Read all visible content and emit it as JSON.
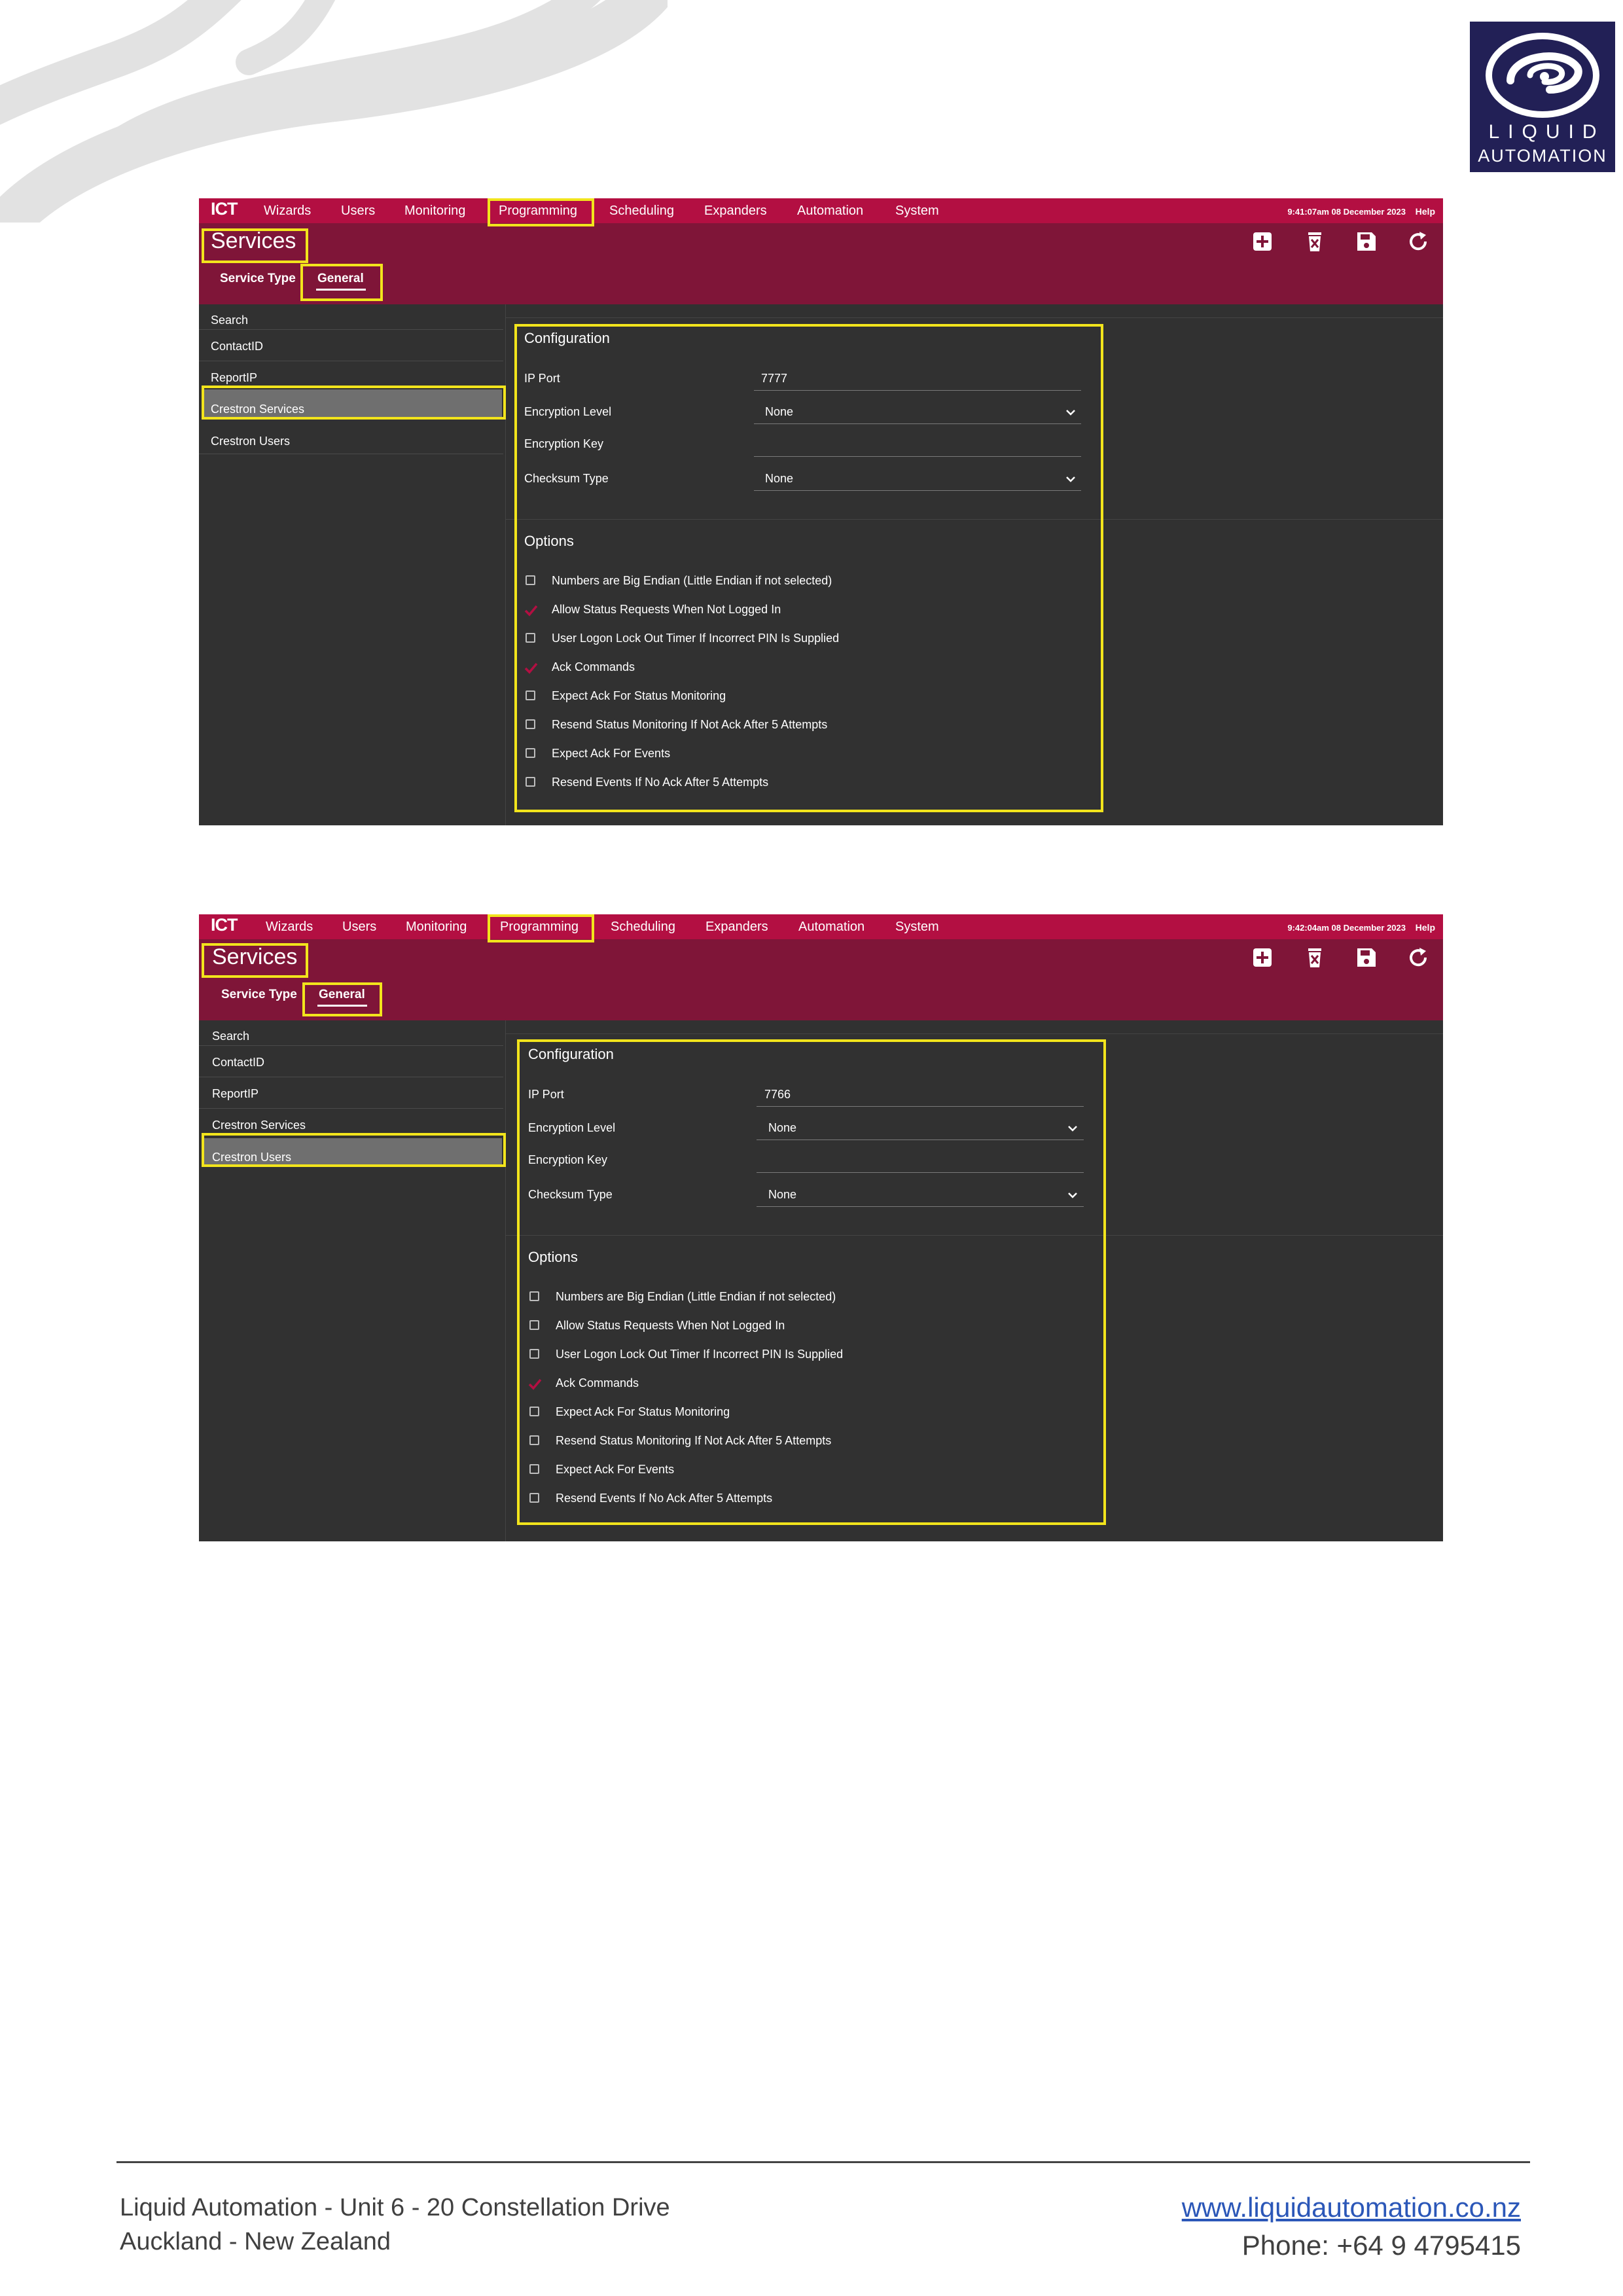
{
  "logo": {
    "line1": "LIQUID",
    "line2": "AUTOMATION"
  },
  "screenshots": [
    {
      "nav": {
        "brand": "ICT",
        "items": [
          "Wizards",
          "Users",
          "Monitoring",
          "Programming",
          "Scheduling",
          "Expanders",
          "Automation",
          "System"
        ],
        "highlighted": "Programming",
        "clock": "9:41:07am 08 December 2023",
        "help": "Help"
      },
      "page_title": "Services",
      "tabs": [
        "Service Type",
        "General"
      ],
      "active_tab": "General",
      "toolbar_icons": [
        "add-icon",
        "delete-icon",
        "save-icon",
        "refresh-icon"
      ],
      "sidebar": {
        "search": "Search",
        "items": [
          "ContactID",
          "ReportIP",
          "Crestron Services",
          "Crestron Users"
        ],
        "selected": "Crestron Services"
      },
      "configuration": {
        "title": "Configuration",
        "ip_port_label": "IP Port",
        "ip_port_value": "7777",
        "encryption_level_label": "Encryption Level",
        "encryption_level_value": "None",
        "encryption_key_label": "Encryption Key",
        "encryption_key_value": "",
        "checksum_type_label": "Checksum Type",
        "checksum_type_value": "None"
      },
      "options": {
        "title": "Options",
        "items": [
          {
            "label": "Numbers are Big Endian (Little Endian if not selected)",
            "checked": false
          },
          {
            "label": "Allow Status Requests When Not Logged In",
            "checked": true
          },
          {
            "label": "User Logon Lock Out Timer If Incorrect PIN Is Supplied",
            "checked": false
          },
          {
            "label": "Ack Commands",
            "checked": true
          },
          {
            "label": "Expect Ack For Status Monitoring",
            "checked": false
          },
          {
            "label": "Resend Status Monitoring If Not Ack After 5 Attempts",
            "checked": false
          },
          {
            "label": "Expect Ack For Events",
            "checked": false
          },
          {
            "label": "Resend Events If No Ack After 5 Attempts",
            "checked": false
          }
        ]
      }
    },
    {
      "nav": {
        "brand": "ICT",
        "items": [
          "Wizards",
          "Users",
          "Monitoring",
          "Programming",
          "Scheduling",
          "Expanders",
          "Automation",
          "System"
        ],
        "highlighted": "Programming",
        "clock": "9:42:04am 08 December 2023",
        "help": "Help"
      },
      "page_title": "Services",
      "tabs": [
        "Service Type",
        "General"
      ],
      "active_tab": "General",
      "toolbar_icons": [
        "add-icon",
        "delete-icon",
        "save-icon",
        "refresh-icon"
      ],
      "sidebar": {
        "search": "Search",
        "items": [
          "ContactID",
          "ReportIP",
          "Crestron Services",
          "Crestron Users"
        ],
        "selected": "Crestron Users"
      },
      "configuration": {
        "title": "Configuration",
        "ip_port_label": "IP Port",
        "ip_port_value": "7766",
        "encryption_level_label": "Encryption Level",
        "encryption_level_value": "None",
        "encryption_key_label": "Encryption Key",
        "encryption_key_value": "",
        "checksum_type_label": "Checksum Type",
        "checksum_type_value": "None"
      },
      "options": {
        "title": "Options",
        "items": [
          {
            "label": "Numbers are Big Endian (Little Endian if not selected)",
            "checked": false
          },
          {
            "label": "Allow Status Requests When Not Logged In",
            "checked": false
          },
          {
            "label": "User Logon Lock Out Timer If Incorrect PIN Is Supplied",
            "checked": false
          },
          {
            "label": "Ack Commands",
            "checked": true
          },
          {
            "label": "Expect Ack For Status Monitoring",
            "checked": false
          },
          {
            "label": "Resend Status Monitoring If Not Ack After 5 Attempts",
            "checked": false
          },
          {
            "label": "Expect Ack For Events",
            "checked": false
          },
          {
            "label": "Resend Events If No Ack After 5 Attempts",
            "checked": false
          }
        ]
      }
    }
  ],
  "footer": {
    "address_line1": "Liquid Automation - Unit 6 - 20 Constellation Drive",
    "address_line2": "Auckland - New Zealand",
    "website": "www.liquidautomation.co.nz",
    "phone": "Phone: +64 9 4795415"
  },
  "colors": {
    "nav_bar": "#b30f42",
    "header": "#7f1538",
    "panel": "#313131",
    "selected_item": "#6f6f6f",
    "highlight_box": "#f2e41c",
    "check": "#b30f42",
    "logo_bg": "#222056"
  }
}
